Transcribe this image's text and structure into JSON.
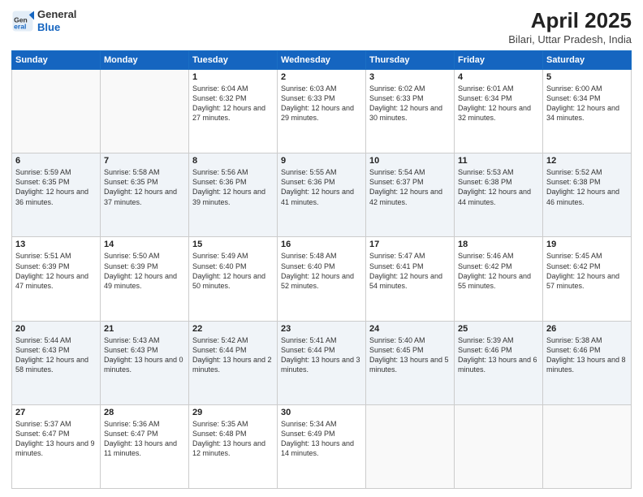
{
  "header": {
    "logo_line1": "General",
    "logo_line2": "Blue",
    "title": "April 2025",
    "subtitle": "Bilari, Uttar Pradesh, India"
  },
  "days_of_week": [
    "Sunday",
    "Monday",
    "Tuesday",
    "Wednesday",
    "Thursday",
    "Friday",
    "Saturday"
  ],
  "weeks": [
    [
      {
        "num": "",
        "info": ""
      },
      {
        "num": "",
        "info": ""
      },
      {
        "num": "1",
        "info": "Sunrise: 6:04 AM\nSunset: 6:32 PM\nDaylight: 12 hours and 27 minutes."
      },
      {
        "num": "2",
        "info": "Sunrise: 6:03 AM\nSunset: 6:33 PM\nDaylight: 12 hours and 29 minutes."
      },
      {
        "num": "3",
        "info": "Sunrise: 6:02 AM\nSunset: 6:33 PM\nDaylight: 12 hours and 30 minutes."
      },
      {
        "num": "4",
        "info": "Sunrise: 6:01 AM\nSunset: 6:34 PM\nDaylight: 12 hours and 32 minutes."
      },
      {
        "num": "5",
        "info": "Sunrise: 6:00 AM\nSunset: 6:34 PM\nDaylight: 12 hours and 34 minutes."
      }
    ],
    [
      {
        "num": "6",
        "info": "Sunrise: 5:59 AM\nSunset: 6:35 PM\nDaylight: 12 hours and 36 minutes."
      },
      {
        "num": "7",
        "info": "Sunrise: 5:58 AM\nSunset: 6:35 PM\nDaylight: 12 hours and 37 minutes."
      },
      {
        "num": "8",
        "info": "Sunrise: 5:56 AM\nSunset: 6:36 PM\nDaylight: 12 hours and 39 minutes."
      },
      {
        "num": "9",
        "info": "Sunrise: 5:55 AM\nSunset: 6:36 PM\nDaylight: 12 hours and 41 minutes."
      },
      {
        "num": "10",
        "info": "Sunrise: 5:54 AM\nSunset: 6:37 PM\nDaylight: 12 hours and 42 minutes."
      },
      {
        "num": "11",
        "info": "Sunrise: 5:53 AM\nSunset: 6:38 PM\nDaylight: 12 hours and 44 minutes."
      },
      {
        "num": "12",
        "info": "Sunrise: 5:52 AM\nSunset: 6:38 PM\nDaylight: 12 hours and 46 minutes."
      }
    ],
    [
      {
        "num": "13",
        "info": "Sunrise: 5:51 AM\nSunset: 6:39 PM\nDaylight: 12 hours and 47 minutes."
      },
      {
        "num": "14",
        "info": "Sunrise: 5:50 AM\nSunset: 6:39 PM\nDaylight: 12 hours and 49 minutes."
      },
      {
        "num": "15",
        "info": "Sunrise: 5:49 AM\nSunset: 6:40 PM\nDaylight: 12 hours and 50 minutes."
      },
      {
        "num": "16",
        "info": "Sunrise: 5:48 AM\nSunset: 6:40 PM\nDaylight: 12 hours and 52 minutes."
      },
      {
        "num": "17",
        "info": "Sunrise: 5:47 AM\nSunset: 6:41 PM\nDaylight: 12 hours and 54 minutes."
      },
      {
        "num": "18",
        "info": "Sunrise: 5:46 AM\nSunset: 6:42 PM\nDaylight: 12 hours and 55 minutes."
      },
      {
        "num": "19",
        "info": "Sunrise: 5:45 AM\nSunset: 6:42 PM\nDaylight: 12 hours and 57 minutes."
      }
    ],
    [
      {
        "num": "20",
        "info": "Sunrise: 5:44 AM\nSunset: 6:43 PM\nDaylight: 12 hours and 58 minutes."
      },
      {
        "num": "21",
        "info": "Sunrise: 5:43 AM\nSunset: 6:43 PM\nDaylight: 13 hours and 0 minutes."
      },
      {
        "num": "22",
        "info": "Sunrise: 5:42 AM\nSunset: 6:44 PM\nDaylight: 13 hours and 2 minutes."
      },
      {
        "num": "23",
        "info": "Sunrise: 5:41 AM\nSunset: 6:44 PM\nDaylight: 13 hours and 3 minutes."
      },
      {
        "num": "24",
        "info": "Sunrise: 5:40 AM\nSunset: 6:45 PM\nDaylight: 13 hours and 5 minutes."
      },
      {
        "num": "25",
        "info": "Sunrise: 5:39 AM\nSunset: 6:46 PM\nDaylight: 13 hours and 6 minutes."
      },
      {
        "num": "26",
        "info": "Sunrise: 5:38 AM\nSunset: 6:46 PM\nDaylight: 13 hours and 8 minutes."
      }
    ],
    [
      {
        "num": "27",
        "info": "Sunrise: 5:37 AM\nSunset: 6:47 PM\nDaylight: 13 hours and 9 minutes."
      },
      {
        "num": "28",
        "info": "Sunrise: 5:36 AM\nSunset: 6:47 PM\nDaylight: 13 hours and 11 minutes."
      },
      {
        "num": "29",
        "info": "Sunrise: 5:35 AM\nSunset: 6:48 PM\nDaylight: 13 hours and 12 minutes."
      },
      {
        "num": "30",
        "info": "Sunrise: 5:34 AM\nSunset: 6:49 PM\nDaylight: 13 hours and 14 minutes."
      },
      {
        "num": "",
        "info": ""
      },
      {
        "num": "",
        "info": ""
      },
      {
        "num": "",
        "info": ""
      }
    ]
  ]
}
